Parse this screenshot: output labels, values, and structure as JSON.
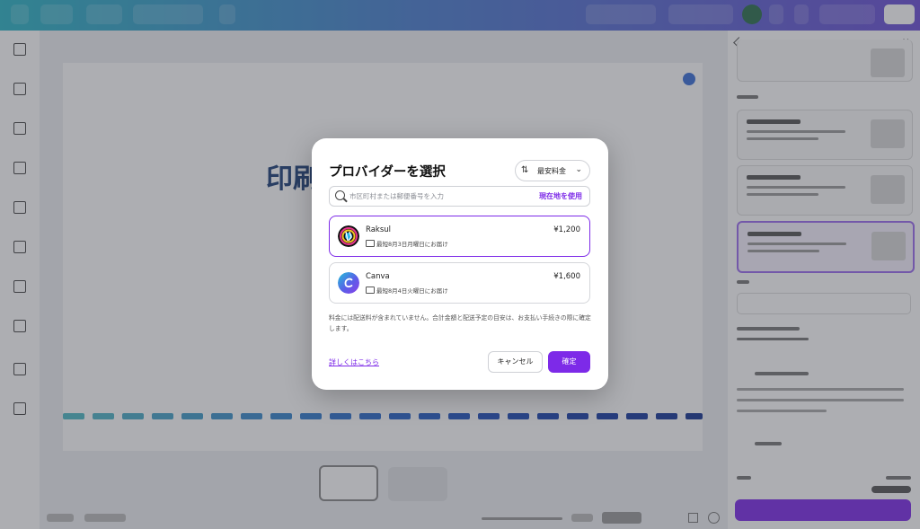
{
  "modal": {
    "title": "プロバイダーを選択",
    "sort_label": "最安料金",
    "search_placeholder": "市区町村または郵便番号を入力",
    "use_location": "現在地を使用",
    "providers": [
      {
        "name": "Raksul",
        "price": "¥1,200",
        "delivery": "最短8月3日月曜日にお届け"
      },
      {
        "name": "Canva",
        "price": "¥1,600",
        "delivery": "最短8月4日火曜日にお届け"
      }
    ],
    "note": "料金には配送料が含まれていません。合計金額と配送予定の目安は、お支払い手続きの際に確定します。",
    "learn_more": "詳しくはこちら",
    "cancel": "キャンセル",
    "confirm": "確定"
  },
  "canvas": {
    "headline": "印刷"
  },
  "colors": {
    "accent": "#7d2ae8",
    "overlay": "rgba(60,62,72,0.42)"
  },
  "icons": [
    "sort-arrows-icon",
    "chevron-down-icon",
    "search-icon",
    "truck-icon",
    "raksul-logo",
    "canva-logo"
  ]
}
